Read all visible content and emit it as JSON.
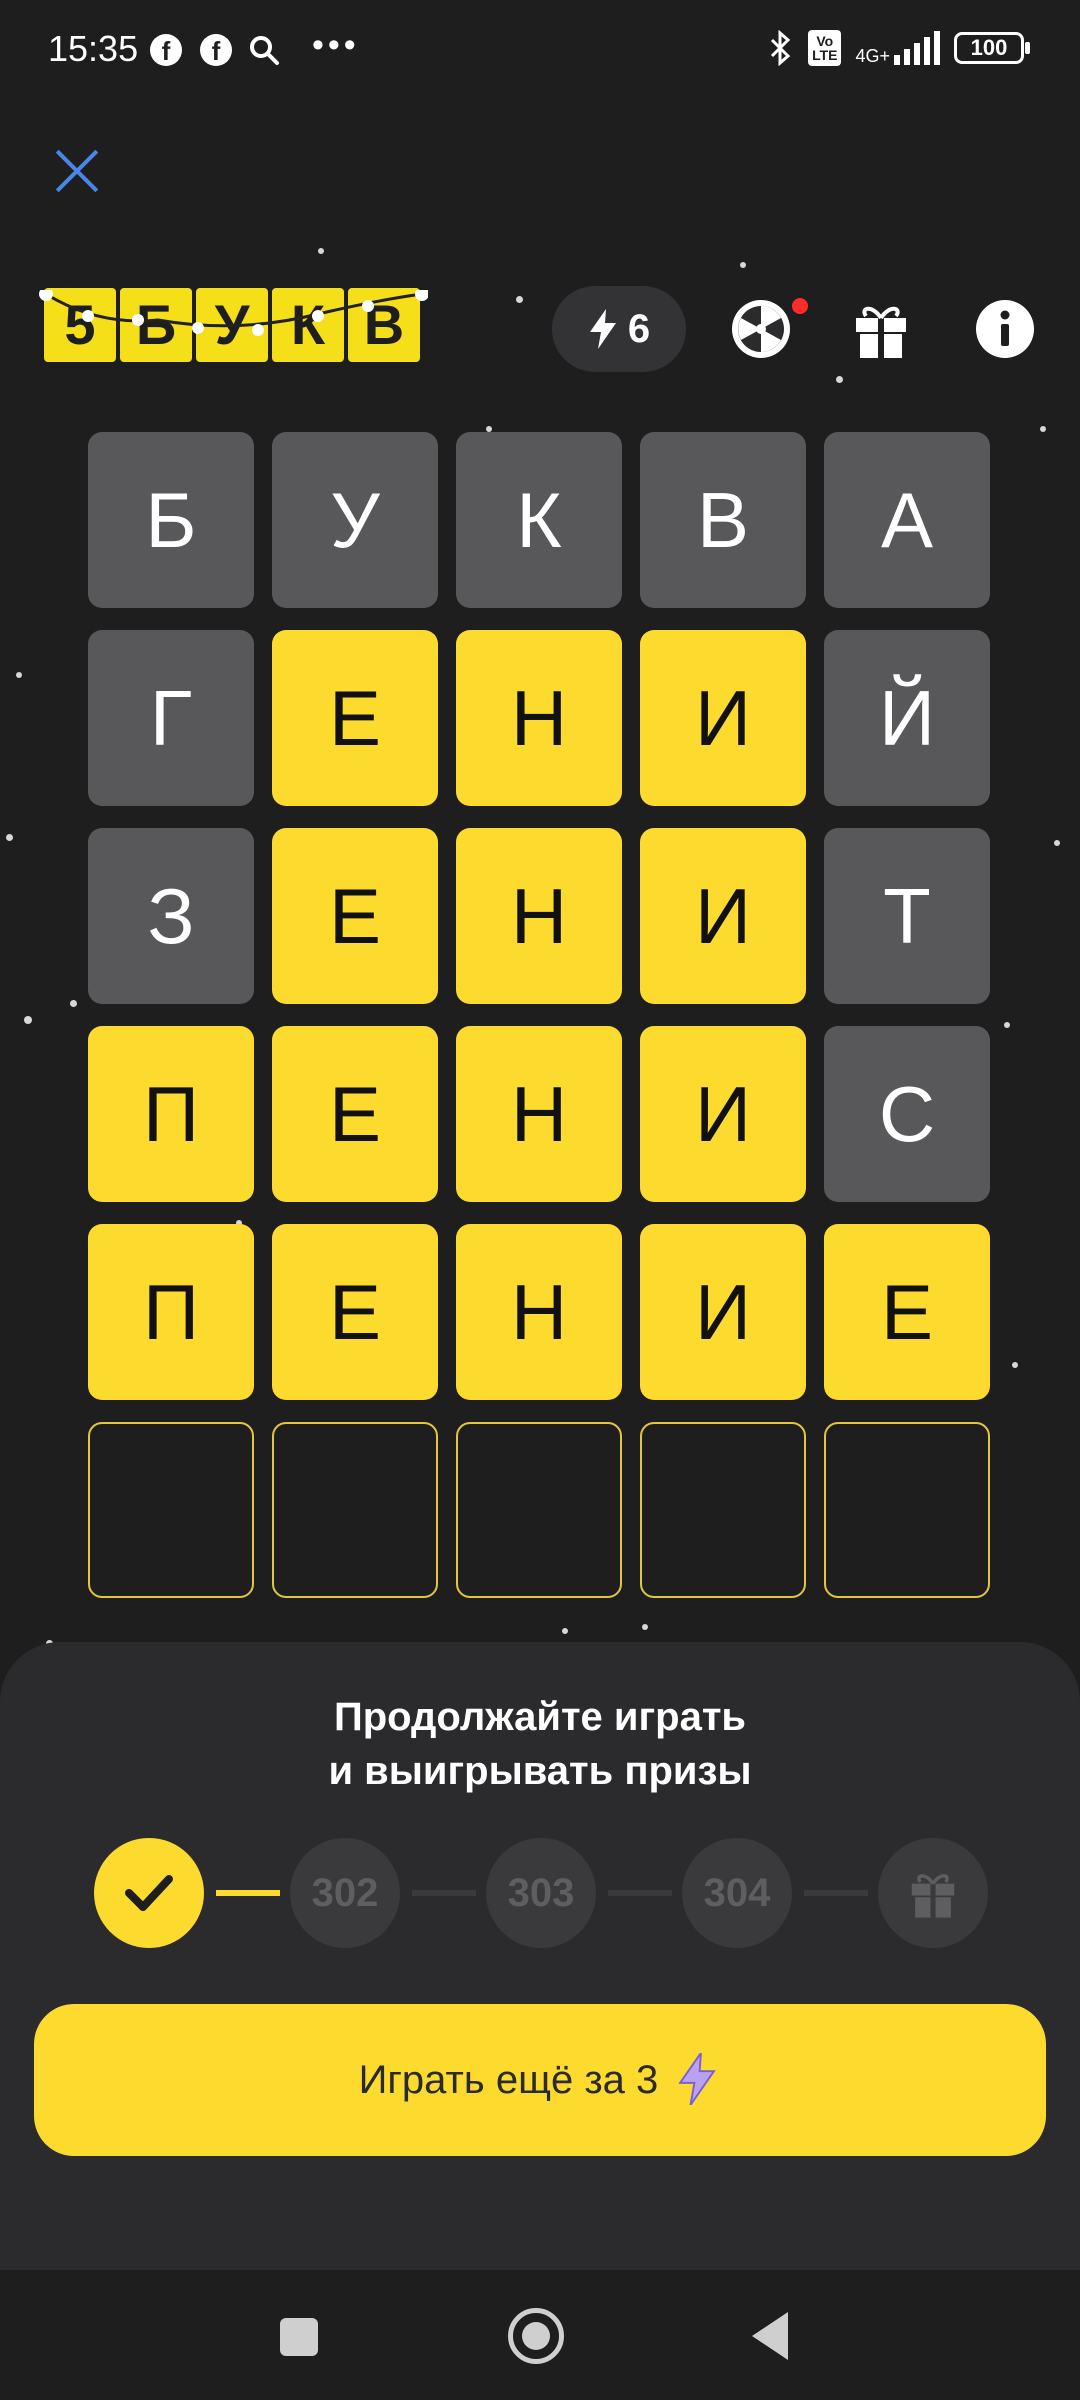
{
  "status_bar": {
    "time": "15:35",
    "network": "4G+",
    "volte": "Vo LTE",
    "battery": "100"
  },
  "header": {
    "logo_letters": [
      "5",
      "Б",
      "У",
      "К",
      "В"
    ],
    "energy_count": "6"
  },
  "grid": {
    "rows": [
      [
        {
          "l": "Б",
          "s": "gray"
        },
        {
          "l": "У",
          "s": "gray"
        },
        {
          "l": "К",
          "s": "gray"
        },
        {
          "l": "В",
          "s": "gray"
        },
        {
          "l": "А",
          "s": "gray"
        }
      ],
      [
        {
          "l": "Г",
          "s": "gray"
        },
        {
          "l": "Е",
          "s": "yellow"
        },
        {
          "l": "Н",
          "s": "yellow"
        },
        {
          "l": "И",
          "s": "yellow"
        },
        {
          "l": "Й",
          "s": "gray"
        }
      ],
      [
        {
          "l": "З",
          "s": "gray"
        },
        {
          "l": "Е",
          "s": "yellow"
        },
        {
          "l": "Н",
          "s": "yellow"
        },
        {
          "l": "И",
          "s": "yellow"
        },
        {
          "l": "Т",
          "s": "gray"
        }
      ],
      [
        {
          "l": "П",
          "s": "yellow"
        },
        {
          "l": "Е",
          "s": "yellow"
        },
        {
          "l": "Н",
          "s": "yellow"
        },
        {
          "l": "И",
          "s": "yellow"
        },
        {
          "l": "С",
          "s": "gray"
        }
      ],
      [
        {
          "l": "П",
          "s": "yellow"
        },
        {
          "l": "Е",
          "s": "yellow"
        },
        {
          "l": "Н",
          "s": "yellow"
        },
        {
          "l": "И",
          "s": "yellow"
        },
        {
          "l": "Е",
          "s": "yellow"
        }
      ],
      [
        {
          "l": "",
          "s": "empty"
        },
        {
          "l": "",
          "s": "empty"
        },
        {
          "l": "",
          "s": "empty"
        },
        {
          "l": "",
          "s": "empty"
        },
        {
          "l": "",
          "s": "empty"
        }
      ]
    ]
  },
  "sheet": {
    "title_line1": "Продолжайте играть",
    "title_line2": "и выигрывать призы",
    "steps": [
      "302",
      "303",
      "304"
    ],
    "play_label": "Играть ещё за 3"
  },
  "colors": {
    "accent": "#fcdb2e",
    "tile_gray": "#58585a",
    "background": "#1e1e1f",
    "close": "#4a86e8",
    "badge": "#ff2a2a"
  },
  "icons": [
    "facebook-icon",
    "search-icon",
    "more-icon",
    "bluetooth-icon",
    "signal-icon",
    "battery-icon",
    "close-icon",
    "lightning-icon",
    "wheel-icon",
    "gift-icon",
    "info-icon",
    "check-icon",
    "recent-apps-icon",
    "home-icon",
    "back-icon"
  ]
}
